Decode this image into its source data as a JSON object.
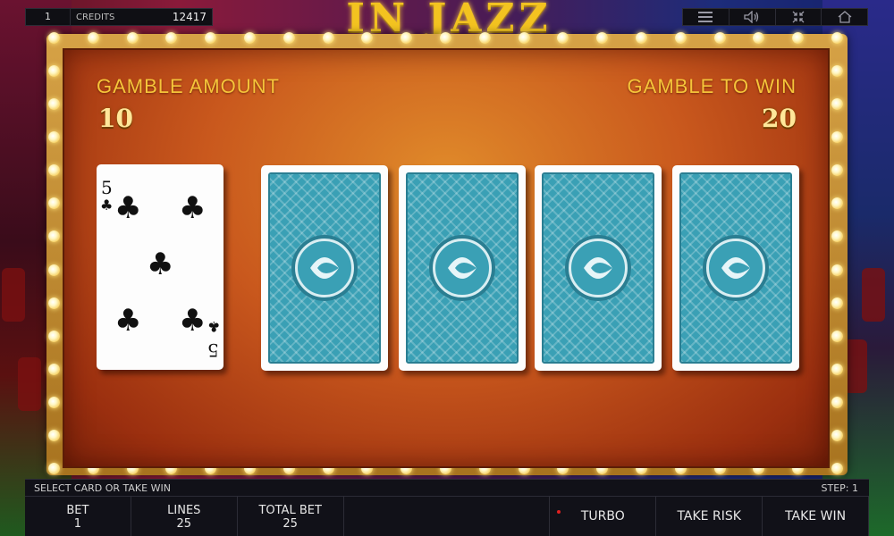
{
  "top_left": {
    "lines": "1",
    "credits_label": "CREDITS",
    "credits_value": "12417"
  },
  "logo": {
    "text": "IN JAZZ"
  },
  "top_icons": [
    "menu-icon",
    "sound-icon",
    "fullscreen-icon",
    "home-icon"
  ],
  "gamble": {
    "amount_label": "GAMBLE AMOUNT",
    "amount_value": "10",
    "to_win_label": "GAMBLE TO WIN",
    "to_win_value": "20"
  },
  "dealer_card": {
    "rank": "5",
    "suit": "♣",
    "suit_name": "clubs"
  },
  "face_down_cards": 4,
  "bottom": {
    "status_message": "SELECT CARD OR TAKE WIN",
    "step": "STEP: 1",
    "bet_label": "BET",
    "bet_value": "1",
    "lines_label": "LINES",
    "lines_value": "25",
    "total_bet_label": "TOTAL BET",
    "total_bet_value": "25",
    "turbo_label": "TURBO",
    "take_risk_label": "TAKE RISK",
    "take_win_label": "TAKE WIN"
  },
  "colors": {
    "accent": "#f5c53a",
    "felt": "#c9581d",
    "card_back": "#3aa0b5"
  }
}
